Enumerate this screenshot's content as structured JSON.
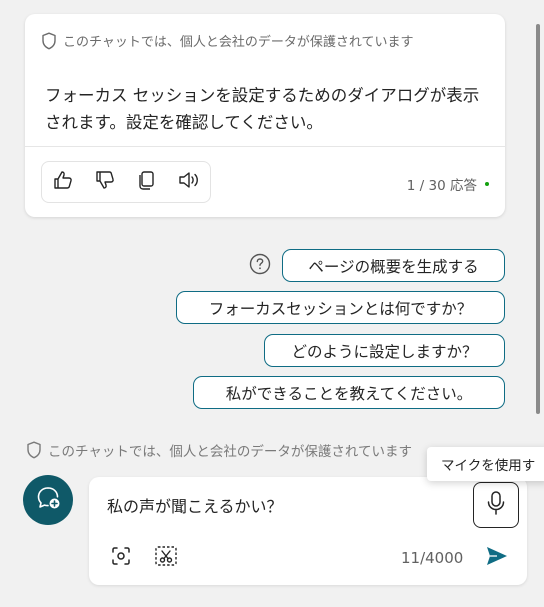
{
  "card": {
    "privacy_notice": "このチャットでは、個人と会社のデータが保護されています",
    "message": "フォーカス セッションを設定するためのダイアログが表示されます。設定を確認してください。",
    "response_count": "1 / 30 応答",
    "actions": [
      "thumbs-up-icon",
      "thumbs-down-icon",
      "copy-icon",
      "read-aloud-icon"
    ]
  },
  "suggestions": [
    "ページの概要を生成する",
    "フォーカスセッションとは何ですか？",
    "どのように設定しますか？",
    "私ができることを教えてください。"
  ],
  "bottom_privacy_notice": "このチャットでは、個人と会社のデータが保護されています",
  "tooltip": "マイクを使用す",
  "composer": {
    "input_value": "私の声が聞こえるかい？",
    "char_count": "11/4000"
  },
  "colors": {
    "accent": "#0f6c84",
    "new_topic_bg": "#0f5968",
    "status_dot": "#13a10e",
    "send": "#0f6c84"
  }
}
